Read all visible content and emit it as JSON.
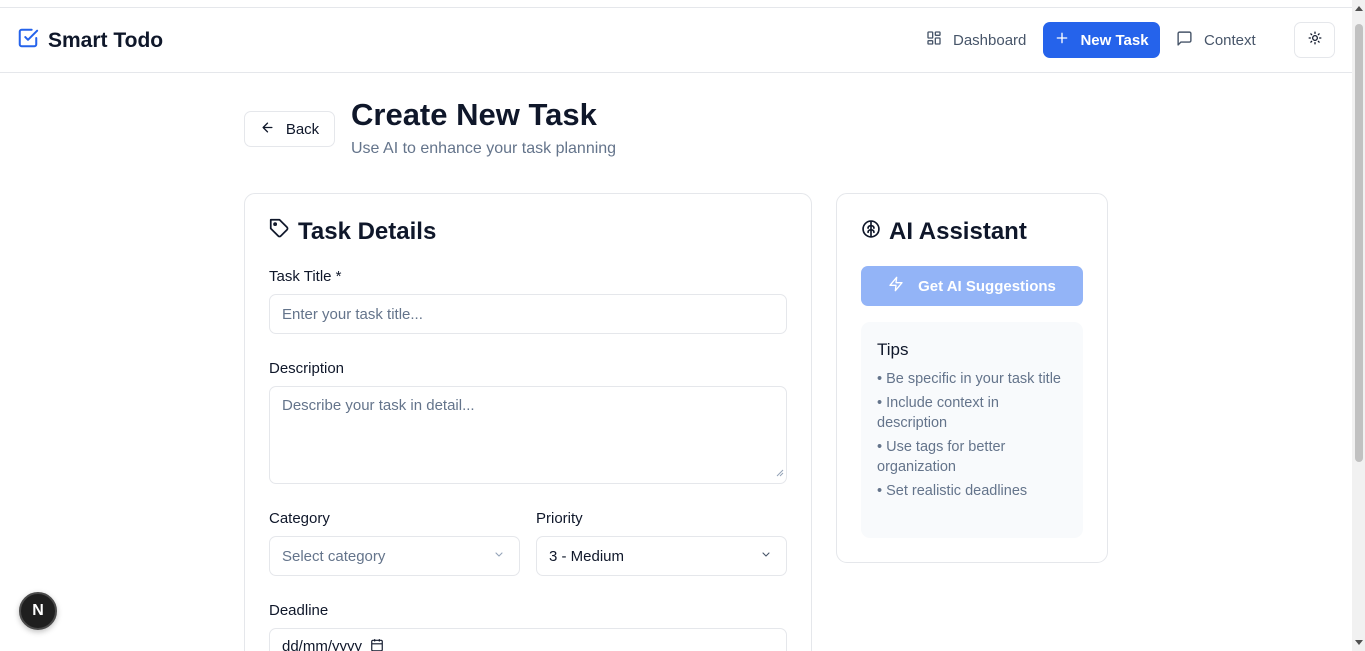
{
  "brand": {
    "name": "Smart Todo",
    "icon": "square-check-icon"
  },
  "nav": {
    "dashboard": "Dashboard",
    "new_task": "New Task",
    "context": "Context"
  },
  "page": {
    "back": "Back",
    "title": "Create New Task",
    "subtitle": "Use AI to enhance your task planning"
  },
  "task_details": {
    "title": "Task Details",
    "title_label": "Task Title *",
    "title_placeholder": "Enter your task title...",
    "description_label": "Description",
    "description_placeholder": "Describe your task in detail...",
    "category_label": "Category",
    "category_value": "Select category",
    "priority_label": "Priority",
    "priority_value": "3 - Medium",
    "deadline_label": "Deadline",
    "deadline_placeholder": "dd/mm/yyyy"
  },
  "ai_assistant": {
    "title": "AI Assistant",
    "button": "Get AI Suggestions",
    "tips_title": "Tips",
    "tips": [
      "• Be specific in your task title",
      "• Include context in description",
      "• Use tags for better organization",
      "• Set realistic deadlines"
    ]
  },
  "badge": {
    "letter": "N"
  },
  "colors": {
    "accent": "#2563eb",
    "ai_button": "#93b4f7"
  }
}
